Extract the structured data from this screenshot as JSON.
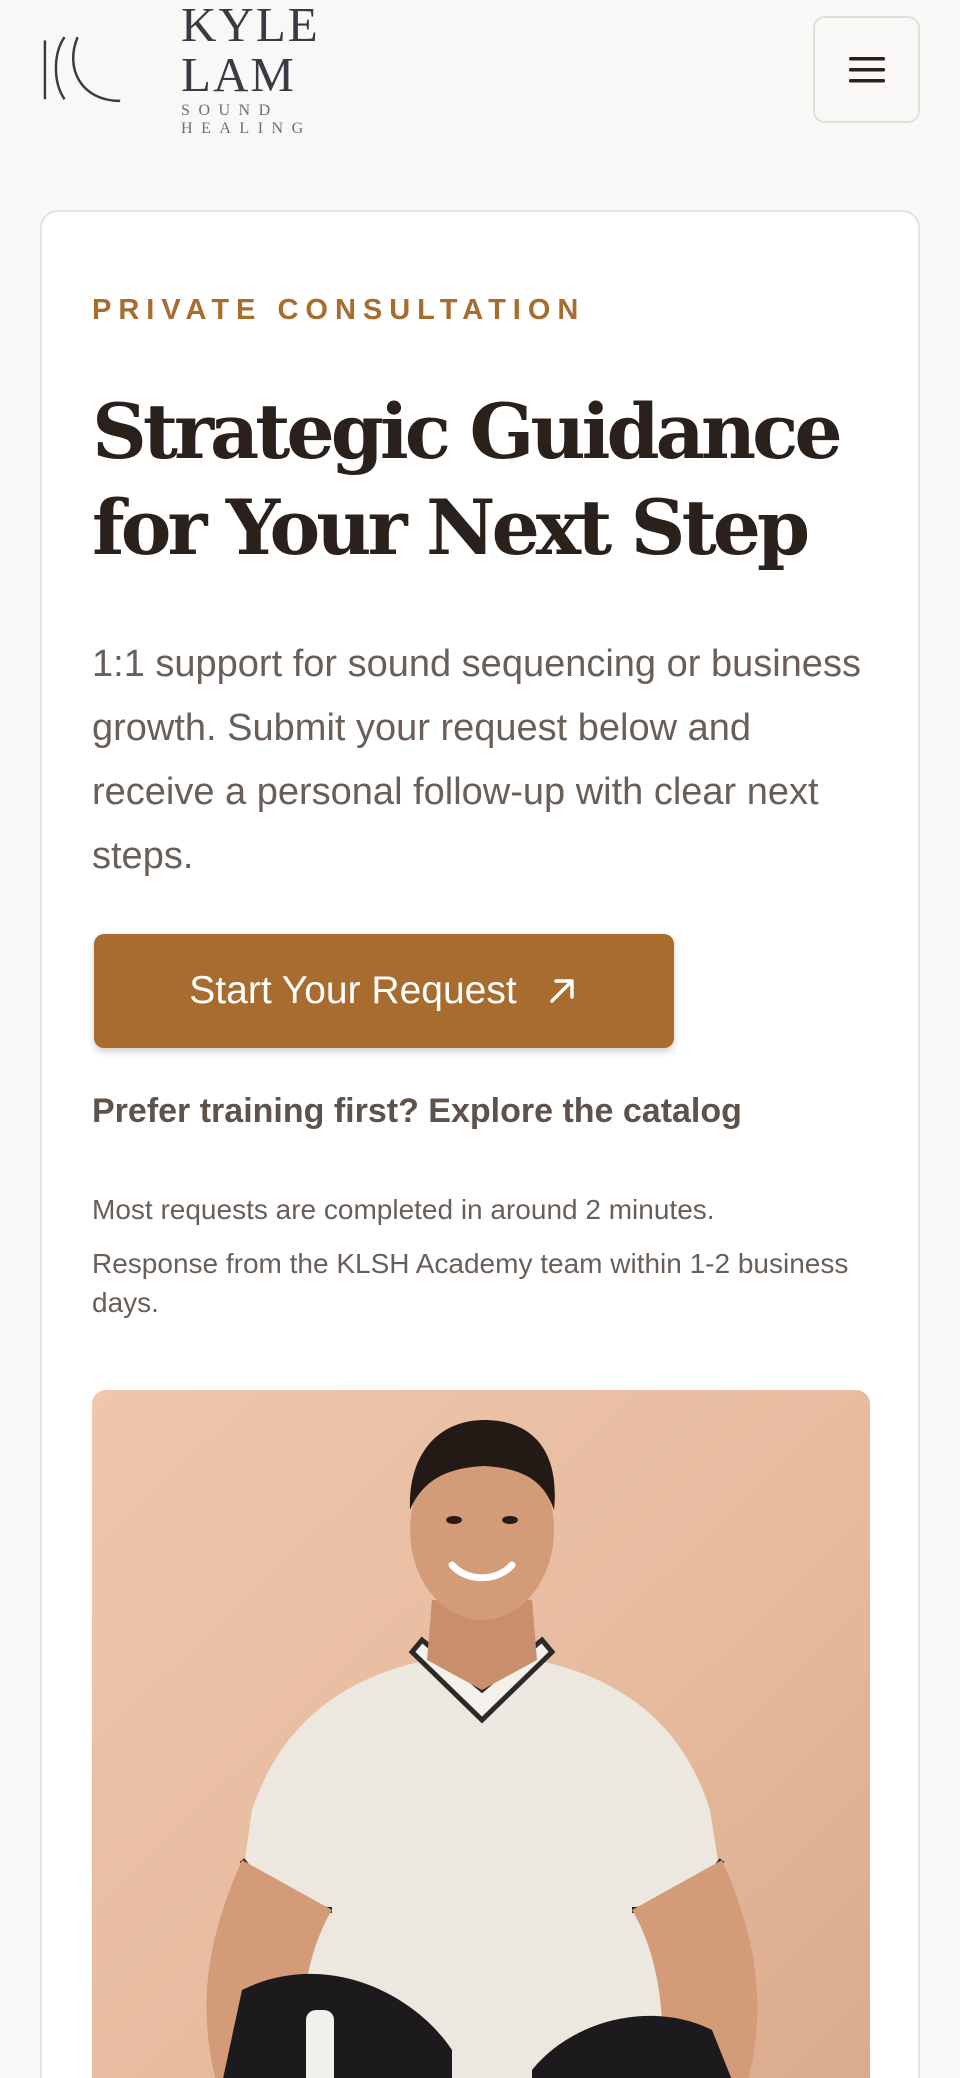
{
  "header": {
    "logo_name": "KYLE LAM",
    "logo_sub": "SOUND HEALING"
  },
  "hero": {
    "eyebrow": "PRIVATE CONSULTATION",
    "title": "Strategic Guidance for Your Next Step",
    "description": "1:1 support for sound sequencing or business growth. Submit your request below and receive a personal follow-up with clear next steps.",
    "cta_label": "Start Your Request",
    "alt_link": "Prefer training first? Explore the catalog",
    "note_1": "Most requests are completed in around 2 minutes.",
    "note_2": "Response from the KLSH Academy team within 1-2 business days."
  },
  "icons": {
    "menu": "hamburger-menu-icon",
    "cta": "arrow-up-right-icon"
  },
  "colors": {
    "accent": "#a76c2e",
    "background": "#f9f8f6",
    "heading": "#2a211c"
  }
}
